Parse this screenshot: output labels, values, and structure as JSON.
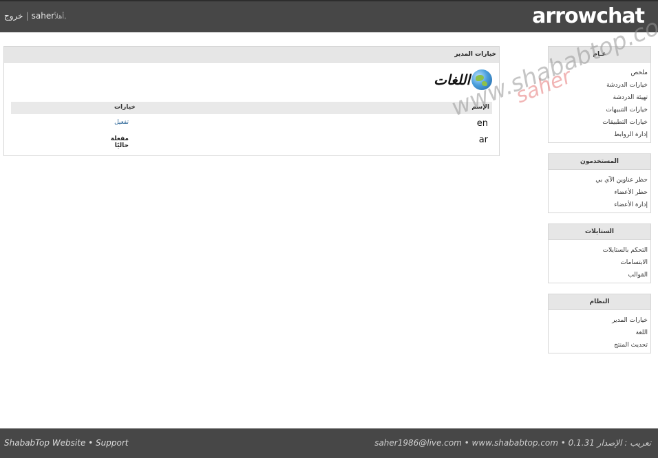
{
  "header": {
    "logo": "arrowchat",
    "greeting": "أهلاً,",
    "username": "saher",
    "logout": "خروج"
  },
  "sidebar": {
    "general": {
      "title": "عـام",
      "items": [
        "ملخص",
        "خيارات الدردشة",
        "تهيئة الدردشة",
        "خيارات التنبيهات",
        "خيارات التطبيقات",
        "إدارة الروابط"
      ]
    },
    "users": {
      "title": "المستخدمون",
      "items": [
        "حظر عناوين الآي بي",
        "حظر الأعضاء",
        "إدارة الأعضاء"
      ]
    },
    "themes": {
      "title": "الستايلات",
      "items": [
        "التحكم بالستايلات",
        "الابتسامات",
        "القوالب"
      ]
    },
    "system": {
      "title": "النظام",
      "items": [
        "خيارات المدير",
        "اللغة",
        "تحديث المنتج"
      ]
    }
  },
  "main": {
    "panel_title": "خيارات المدير",
    "section_title": "اللغات",
    "columns": {
      "name": "الإسم",
      "options": "خيارات"
    },
    "rows": [
      {
        "code": "en",
        "option": "تفعيل"
      },
      {
        "code": "ar",
        "option": "مفعلة حاليًا"
      }
    ]
  },
  "watermark": {
    "line1": "saher",
    "line2": "www.shababtop.com"
  },
  "footer": {
    "left": "ShababTop Website • Support",
    "right": "saher1986@live.com • www.shababtop.com • تعريب : الإصدار 0.1.31"
  }
}
